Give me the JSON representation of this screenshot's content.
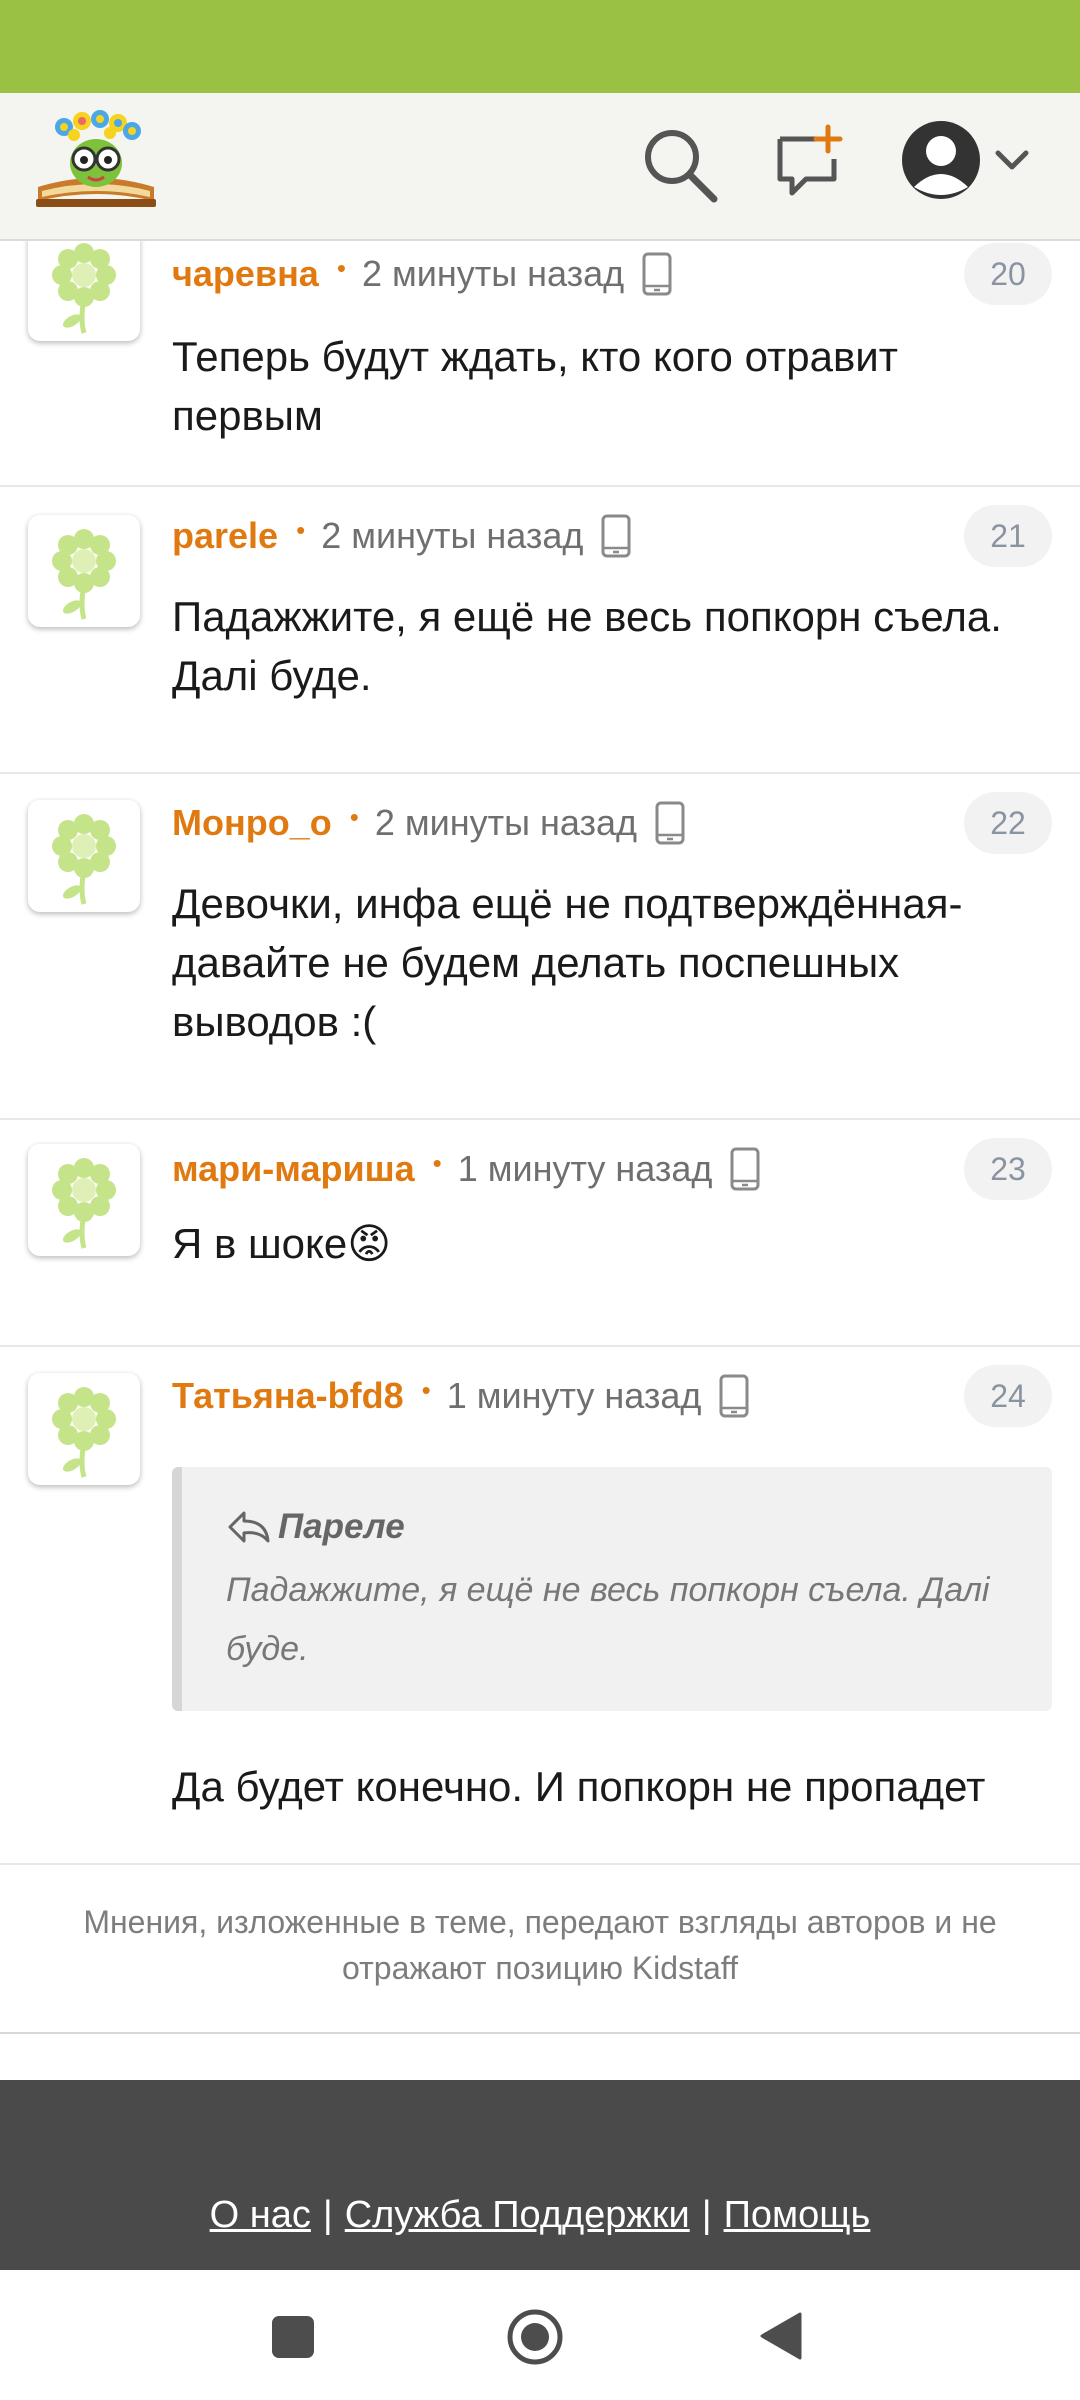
{
  "header": {
    "logo_name": "kidstaff-logo",
    "icons": [
      "search-icon",
      "new-topic-icon",
      "account-avatar-icon",
      "chevron-down-icon"
    ]
  },
  "comments": [
    {
      "author": "чаревна",
      "time": "2 минуты назад",
      "number": "20",
      "text": "Теперь будут ждать, кто кого отравит первым"
    },
    {
      "author": "parele",
      "time": "2 минуты назад",
      "number": "21",
      "text": "Падажжите, я ещё не весь попкорн съела. Далі буде."
    },
    {
      "author": "Монро_о",
      "time": "2 минуты назад",
      "number": "22",
      "text": "Девочки, инфа ещё не подтверждённая- давайте не будем делать поспешных выводов :("
    },
    {
      "author": "мари-мариша",
      "time": "1 минуту назад",
      "number": "23",
      "text": "Я в шоке😡"
    },
    {
      "author": "Татьяна-bfd8",
      "time": "1 минуту назад",
      "number": "24",
      "text": "Да будет конечно. И попкорн не пропадет",
      "quote": {
        "author": "Пареле",
        "text": "Падажжите, я ещё не весь попкорн съела. Далі буде."
      }
    }
  ],
  "meta_dot": "•",
  "disclaimer": "Мнения, изложенные в теме, передают взгляды авторов и не отражают позицию Kidstaff",
  "footer": {
    "links": [
      "О нас",
      "Служба Поддержки",
      "Помощь"
    ],
    "separator": "|"
  },
  "colors": {
    "status_bar": "#9bc144",
    "author": "#e07a10",
    "footer_bg": "#4a4a4a"
  }
}
